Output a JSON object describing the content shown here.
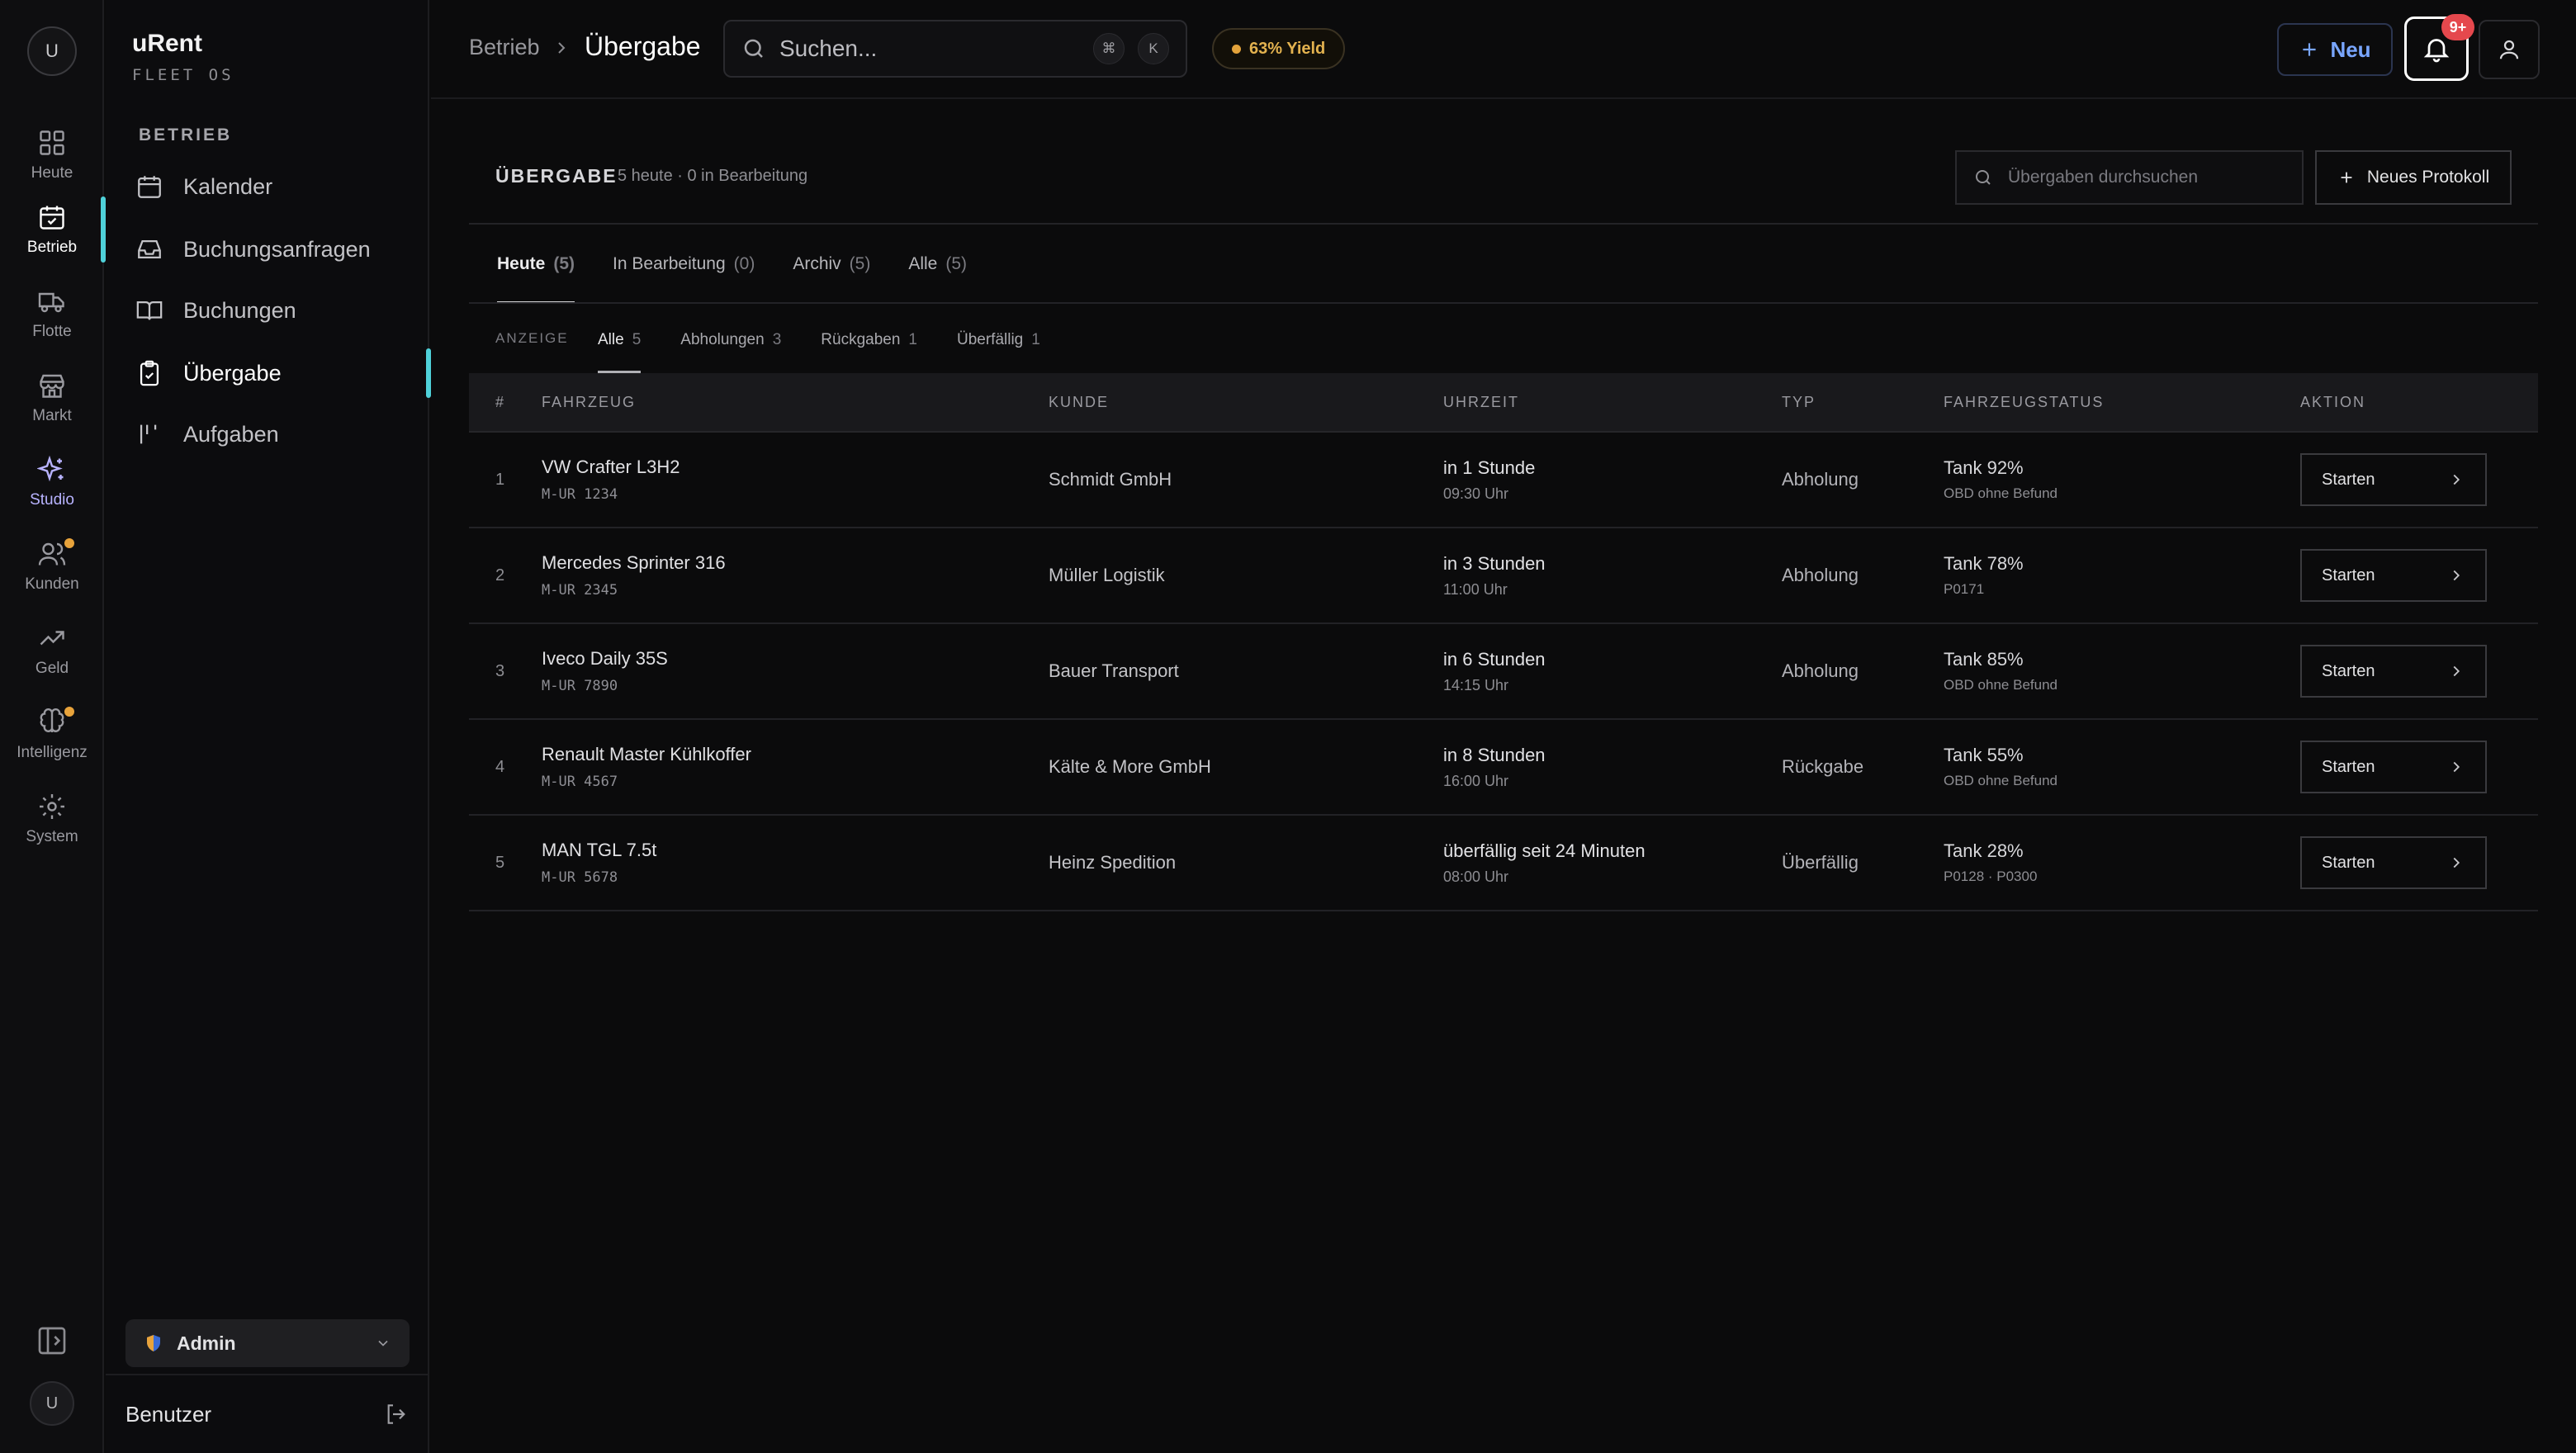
{
  "rail": {
    "avatar": "U",
    "items": [
      {
        "label": "Heute",
        "icon": "dashboard-icon"
      },
      {
        "label": "Betrieb",
        "icon": "calendar-check-icon"
      },
      {
        "label": "Flotte",
        "icon": "truck-icon"
      },
      {
        "label": "Markt",
        "icon": "store-icon"
      },
      {
        "label": "Studio",
        "icon": "sparkles-icon"
      },
      {
        "label": "Kunden",
        "icon": "users-icon"
      },
      {
        "label": "Geld",
        "icon": "trending-up-icon"
      },
      {
        "label": "Intelligenz",
        "icon": "brain-icon"
      },
      {
        "label": "System",
        "icon": "gear-icon"
      }
    ],
    "user_initial": "U"
  },
  "sidebar": {
    "brand": "uRent",
    "brand_sub": "FLEET OS",
    "section": "BETRIEB",
    "items": [
      {
        "label": "Kalender",
        "icon": "calendar-icon"
      },
      {
        "label": "Buchungsanfragen",
        "icon": "inbox-icon"
      },
      {
        "label": "Buchungen",
        "icon": "book-icon"
      },
      {
        "label": "Übergabe",
        "icon": "clipboard-check-icon"
      },
      {
        "label": "Aufgaben",
        "icon": "tasks-icon"
      }
    ],
    "role": "Admin",
    "footer_user": "Benutzer"
  },
  "topbar": {
    "breadcrumb_parent": "Betrieb",
    "breadcrumb_current": "Übergabe",
    "search_placeholder": "Suchen...",
    "kbd_1": "⌘",
    "kbd_2": "K",
    "yield": "63% Yield",
    "new_label": "Neu",
    "notif_badge": "9+"
  },
  "main": {
    "title": "ÜBERGABE",
    "subtitle": "5 heute · 0 in Bearbeitung",
    "filter_placeholder": "Übergaben durchsuchen",
    "new_protocol": "Neues Protokoll",
    "tabs": [
      {
        "label": "Heute",
        "count": "(5)"
      },
      {
        "label": "In Bearbeitung",
        "count": "(0)"
      },
      {
        "label": "Archiv",
        "count": "(5)"
      },
      {
        "label": "Alle",
        "count": "(5)"
      }
    ],
    "seg_label": "ANZEIGE",
    "segments": [
      {
        "label": "Alle",
        "count": "5"
      },
      {
        "label": "Abholungen",
        "count": "3"
      },
      {
        "label": "Rückgaben",
        "count": "1"
      },
      {
        "label": "Überfällig",
        "count": "1"
      }
    ],
    "columns": [
      "#",
      "FAHRZEUG",
      "KUNDE",
      "UHRZEIT",
      "TYP",
      "FAHRZEUGSTATUS",
      "AKTION"
    ],
    "rows": [
      {
        "num": "1",
        "vehicle": "VW Crafter L3H2",
        "plate": "M-UR 1234",
        "customer": "Schmidt GmbH",
        "time": "in 1 Stunde",
        "clock": "09:30 Uhr",
        "type": "Abholung",
        "status": "Tank 92%",
        "status_sub": "OBD ohne Befund",
        "action": "Starten"
      },
      {
        "num": "2",
        "vehicle": "Mercedes Sprinter 316",
        "plate": "M-UR 2345",
        "customer": "Müller Logistik",
        "time": "in 3 Stunden",
        "clock": "11:00 Uhr",
        "type": "Abholung",
        "status": "Tank 78%",
        "status_sub": "P0171",
        "action": "Starten"
      },
      {
        "num": "3",
        "vehicle": "Iveco Daily 35S",
        "plate": "M-UR 7890",
        "customer": "Bauer Transport",
        "time": "in 6 Stunden",
        "clock": "14:15 Uhr",
        "type": "Abholung",
        "status": "Tank 85%",
        "status_sub": "OBD ohne Befund",
        "action": "Starten"
      },
      {
        "num": "4",
        "vehicle": "Renault Master Kühlkoffer",
        "plate": "M-UR 4567",
        "customer": "Kälte & More GmbH",
        "time": "in 8 Stunden",
        "clock": "16:00 Uhr",
        "type": "Rückgabe",
        "status": "Tank 55%",
        "status_sub": "OBD ohne Befund",
        "action": "Starten"
      },
      {
        "num": "5",
        "vehicle": "MAN TGL 7.5t",
        "plate": "M-UR 5678",
        "customer": "Heinz Spedition",
        "time": "überfällig seit 24 Minuten",
        "clock": "08:00 Uhr",
        "type": "Überfällig",
        "status": "Tank 28%",
        "status_sub": "P0128 · P0300",
        "action": "Starten"
      }
    ]
  }
}
